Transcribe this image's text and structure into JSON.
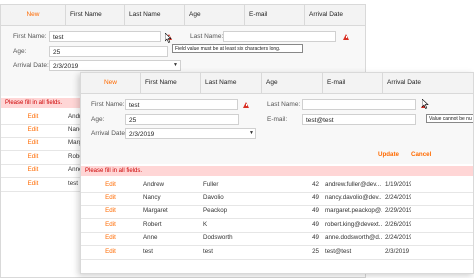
{
  "back_grid": {
    "headers": {
      "new": "New",
      "first_name": "First Name",
      "last_name": "Last Name",
      "age": "Age",
      "email": "E-mail",
      "arrival": "Arrival Date"
    },
    "form": {
      "first_name_label": "First Name:",
      "first_name_value": "test",
      "last_name_label": "Last Name:",
      "last_name_value": "",
      "age_label": "Age:",
      "age_value": "25",
      "arrival_label": "Arrival Date:",
      "arrival_value": "2/3/2019"
    },
    "tooltip": "Field value must be at least six characters long.",
    "error": "Please fill in all fields.",
    "rows": [
      {
        "edit": "Edit",
        "first": "Andrew"
      },
      {
        "edit": "Edit",
        "first": "Nancy"
      },
      {
        "edit": "Edit",
        "first": "Margaret"
      },
      {
        "edit": "Edit",
        "first": "Robert"
      },
      {
        "edit": "Edit",
        "first": "Anne"
      },
      {
        "edit": "Edit",
        "first": "test"
      }
    ]
  },
  "front_grid": {
    "headers": {
      "new": "New",
      "first_name": "First Name",
      "last_name": "Last Name",
      "age": "Age",
      "email": "E-mail",
      "arrival": "Arrival Date"
    },
    "form": {
      "first_name_label": "First Name:",
      "first_name_value": "test",
      "last_name_label": "Last Name:",
      "last_name_value": "",
      "age_label": "Age:",
      "age_value": "25",
      "email_label": "E-mail:",
      "email_value": "test@test",
      "arrival_label": "Arrival Date:",
      "arrival_value": "2/3/2019",
      "update": "Update",
      "cancel": "Cancel"
    },
    "tooltip": "Value cannot be nu",
    "error": "Please fill in all fields.",
    "rows": [
      {
        "edit": "Edit",
        "first": "Andrew",
        "last": "Fuller",
        "age": "42",
        "email": "andrew.fuller@dev...",
        "arrival": "1/19/2019"
      },
      {
        "edit": "Edit",
        "first": "Nancy",
        "last": "Davolio",
        "age": "49",
        "email": "nancy.davolio@dev...",
        "arrival": "2/24/2019"
      },
      {
        "edit": "Edit",
        "first": "Margaret",
        "last": "Peackop",
        "age": "49",
        "email": "margaret.peackop@...",
        "arrival": "2/29/2019"
      },
      {
        "edit": "Edit",
        "first": "Robert",
        "last": "K",
        "age": "49",
        "email": "robert.king@devext...",
        "arrival": "2/26/2019"
      },
      {
        "edit": "Edit",
        "first": "Anne",
        "last": "Dodsworth",
        "age": "49",
        "email": "anne.dodsworth@d...",
        "arrival": "2/24/2019"
      },
      {
        "edit": "Edit",
        "first": "test",
        "last": "test",
        "age": "25",
        "email": "test@test",
        "arrival": "2/3/2019"
      }
    ]
  },
  "colors": {
    "accent": "#ff6a00",
    "error_bg": "#ffd6d6",
    "warn": "#d93025"
  },
  "icons": {
    "warning": "warning-icon",
    "dropdown": "chevron-down-icon",
    "cursor": "mouse-pointer-icon"
  }
}
